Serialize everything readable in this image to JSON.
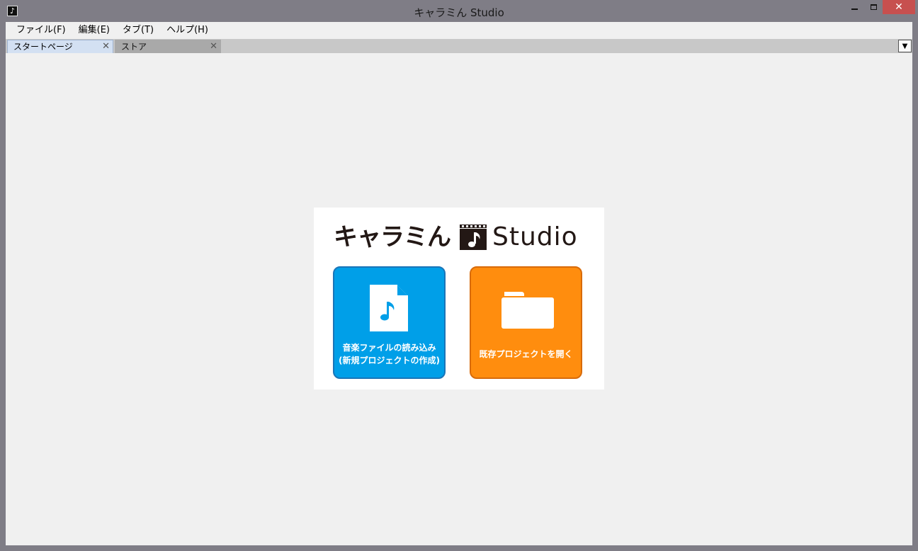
{
  "window": {
    "title": "キャラミん Studio",
    "controls": {
      "minimize": "minimize",
      "maximize": "maximize",
      "close": "✕"
    }
  },
  "menubar": {
    "items": [
      {
        "label": "ファイル(F)"
      },
      {
        "label": "編集(E)"
      },
      {
        "label": "タブ(T)"
      },
      {
        "label": "ヘルプ(H)"
      }
    ]
  },
  "tabs": [
    {
      "label": "スタートページ",
      "active": true,
      "close": "✕"
    },
    {
      "label": "ストア",
      "active": false,
      "close": "✕"
    }
  ],
  "tab_menu_glyph": "▼",
  "start_page": {
    "logo": {
      "jp": "キャラミん",
      "en": "Studio",
      "mark_icon": "film-music-note-icon"
    },
    "load_button": {
      "line1": "音楽ファイルの読み込み",
      "line2": "(新規プロジェクトの作成)",
      "icon": "music-file-icon",
      "color": "#009fe8"
    },
    "open_button": {
      "label": "既存プロジェクトを開く",
      "icon": "folder-icon",
      "color": "#ff8d0e"
    }
  },
  "colors": {
    "chrome": "#7f7d86",
    "close_button": "#c7504f",
    "content_bg": "#f0f0f0",
    "active_tab": "#d3e0f2"
  }
}
